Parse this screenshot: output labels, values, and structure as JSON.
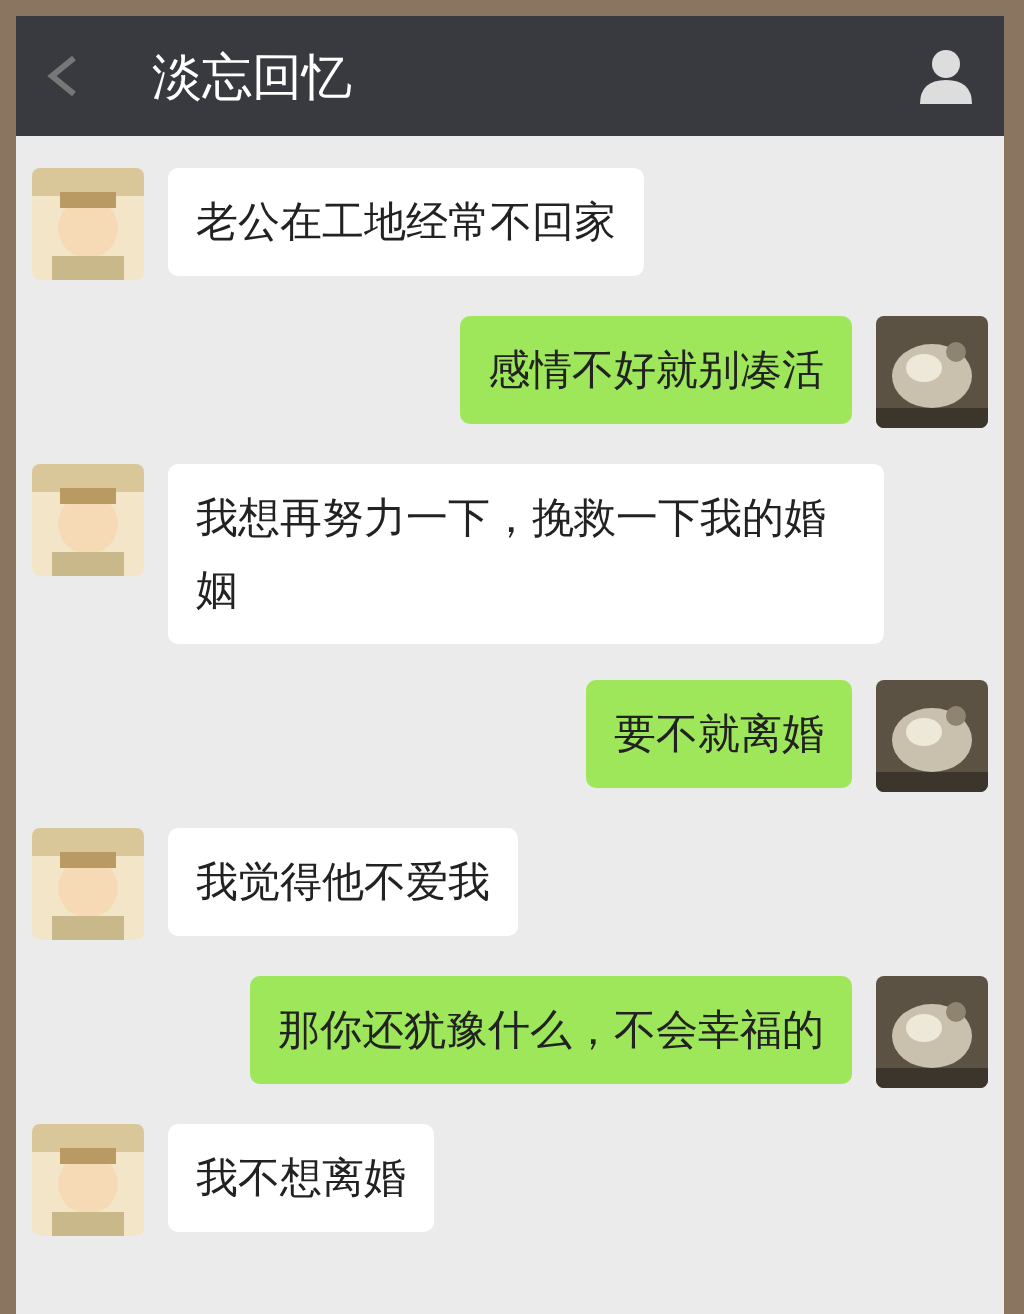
{
  "header": {
    "title": "淡忘回忆"
  },
  "messages": [
    {
      "kind": "incoming",
      "text": "老公在工地经常不回家"
    },
    {
      "kind": "outgoing",
      "text": "感情不好就别凑活"
    },
    {
      "kind": "incoming",
      "text": "我想再努力一下，挽救一下我的婚姻"
    },
    {
      "kind": "outgoing",
      "text": "要不就离婚"
    },
    {
      "kind": "incoming",
      "text": "我觉得他不爱我"
    },
    {
      "kind": "outgoing",
      "text": "那你还犹豫什么，不会幸福的"
    },
    {
      "kind": "incoming",
      "text": "我不想离婚"
    }
  ]
}
